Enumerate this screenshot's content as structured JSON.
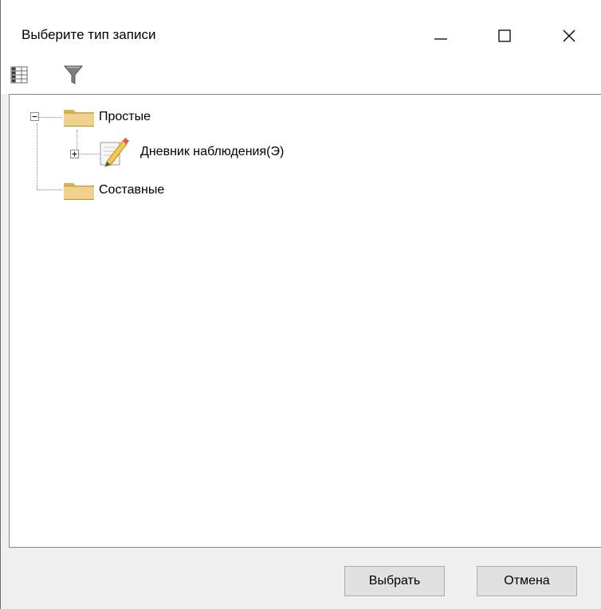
{
  "window": {
    "title": "Выберите тип записи"
  },
  "toolbar": {
    "grid_icon": "table-view-icon",
    "filter_icon": "filter-icon"
  },
  "tree": {
    "nodes": [
      {
        "label": "Простые",
        "icon": "folder-icon",
        "expanded": true
      },
      {
        "label": "Дневник наблюдения(Э)",
        "icon": "edit-document-icon",
        "expanded": false
      },
      {
        "label": "Составные",
        "icon": "folder-icon"
      }
    ]
  },
  "footer": {
    "ok_label": "Выбрать",
    "cancel_label": "Отмена"
  },
  "colors": {
    "folder": "#e8c77a",
    "button_bg": "#e1e1e1",
    "panel_border": "#828790"
  }
}
